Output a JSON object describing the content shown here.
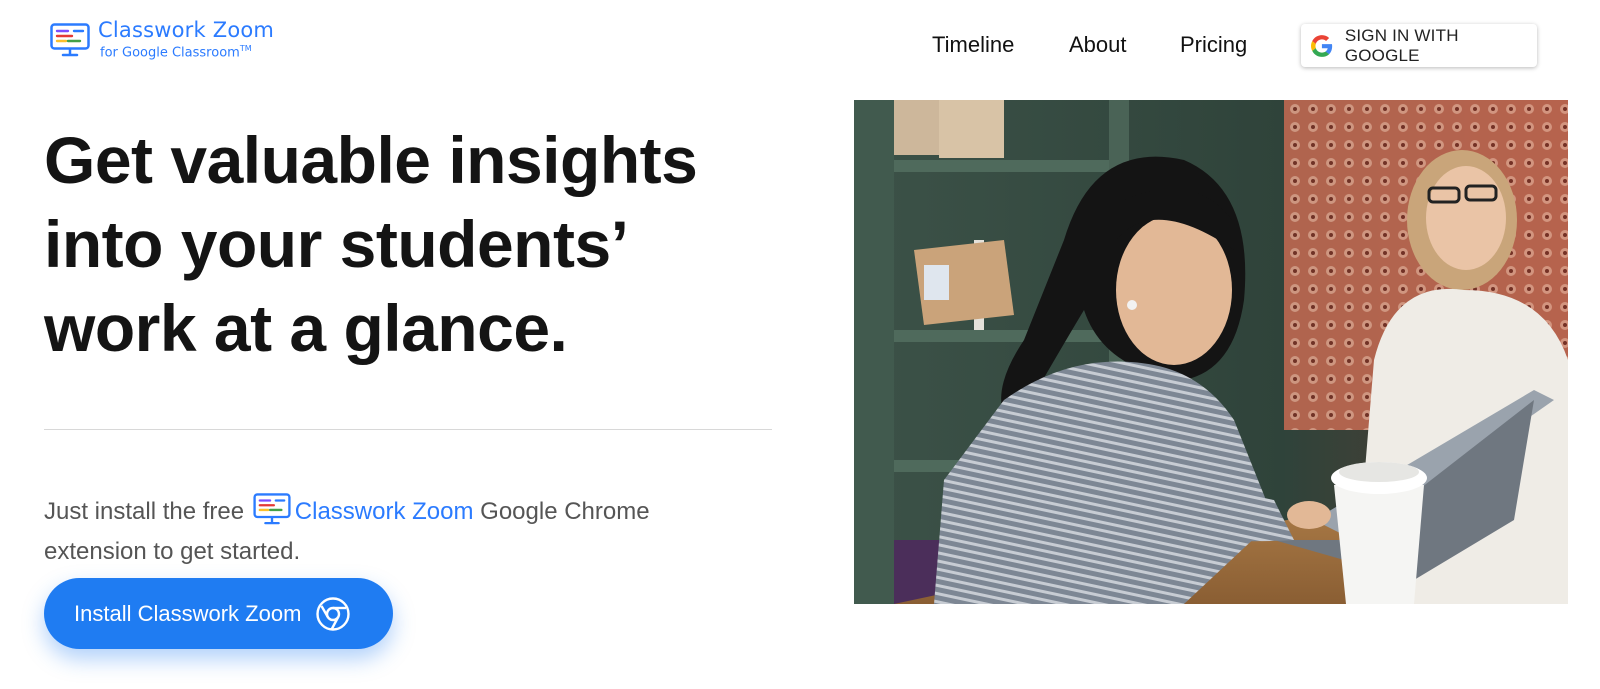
{
  "header": {
    "logo": {
      "title": "Classwork Zoom",
      "subtitle": "for Google Classroom",
      "trademark": "TM",
      "icon": "monitor-logo-icon"
    },
    "nav": {
      "items": [
        {
          "label": "Timeline"
        },
        {
          "label": "About"
        },
        {
          "label": "Pricing"
        }
      ],
      "signin": {
        "label": "SIGN IN WITH GOOGLE",
        "icon": "google-g-icon"
      }
    }
  },
  "hero": {
    "headline": {
      "line1": "Get valuable insights",
      "line2": "into your students’",
      "line3": "work at a glance."
    },
    "description": {
      "prefix": "Just install the free",
      "brand": "Classwork Zoom",
      "suffix": "Google Chrome",
      "line2": "extension to get started."
    },
    "install_button": {
      "label": "Install Classwork Zoom",
      "icon": "chrome-icon"
    },
    "photo": {
      "icon": "students-photo"
    }
  },
  "colors": {
    "brand_blue": "#2b7bff",
    "button_blue": "#1f7cf2",
    "headline": "#141414",
    "body_text": "#555555"
  }
}
